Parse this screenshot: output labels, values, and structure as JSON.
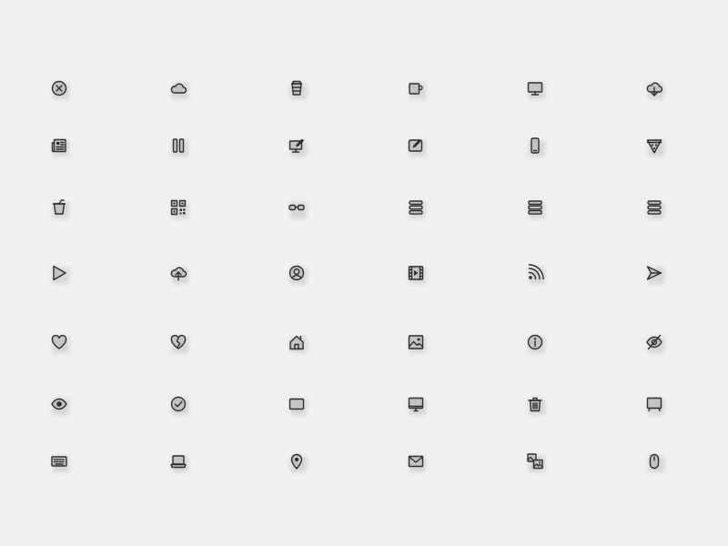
{
  "icons": [
    "close-circle-icon",
    "cloud-icon",
    "coffee-cup-icon",
    "mug-icon",
    "monitor-icon",
    "cloud-download-icon",
    "newspaper-icon",
    "pause-icon",
    "desktop-edit-icon",
    "tablet-edit-icon",
    "smartphone-icon",
    "pizza-slice-icon",
    "drink-cup-icon",
    "qr-code-icon",
    "glasses-icon",
    "menu-bars-icon",
    "menu-bars-alt-icon",
    "menu-bars-dense-icon",
    "play-icon",
    "cloud-upload-icon",
    "user-circle-icon",
    "film-play-icon",
    "rss-icon",
    "send-icon",
    "heart-icon",
    "broken-heart-icon",
    "home-icon",
    "image-icon",
    "info-icon",
    "eye-off-icon",
    "eye-icon",
    "check-circle-icon",
    "tablet-landscape-icon",
    "display-icon",
    "trash-icon",
    "tv-icon",
    "keyboard-icon",
    "laptop-icon",
    "map-pin-icon",
    "mail-icon",
    "image-gallery-icon",
    "mouse-icon"
  ],
  "colors": {
    "background": "#f0f0f0",
    "icon_stroke": "#2e2e2e",
    "icon_fill": "#c4c4c4"
  }
}
